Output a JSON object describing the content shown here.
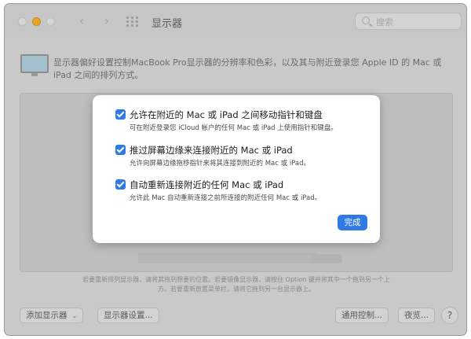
{
  "window": {
    "title": "显示器",
    "search_placeholder": "搜索",
    "back_icon": "‹",
    "forward_icon": "›"
  },
  "header": {
    "description": "显示器偏好设置控制MacBook Pro显示器的分辨率和色彩，以及其与附近登录您 Apple ID 的 Mac 或 iPad 之间的排列方式。"
  },
  "arrangement": {
    "hint_line1": "若要重新排列显示器，请将其拖到想要的位置。若要镜像显示器，请按住 Option 键并将其中一个拖到另一个上",
    "hint_line2": "方。若要重新放置菜单栏，请将它拖到另一台显示器上。"
  },
  "footer": {
    "add_display": "添加显示器",
    "display_settings": "显示器设置...",
    "universal_control": "通用控制...",
    "night_shift": "夜览...",
    "help": "?"
  },
  "sheet": {
    "options": [
      {
        "title": "允许在附近的 Mac 或 iPad 之间移动指针和键盘",
        "subtitle": "可在附近登录您 iCloud 帐户的任何 Mac 或 iPad 上使用指针和键盘。",
        "checked": true
      },
      {
        "title": "推过屏幕边缘来连接附近的 Mac 或 iPad",
        "subtitle": "允许向屏幕边缘拖移指针来将其连接到附近的 Mac 或 iPad。",
        "checked": true
      },
      {
        "title": "自动重新连接附近的任何 Mac 或 iPad",
        "subtitle": "允许此 Mac 自动重新连接之前所连接的附近任何 Mac 或 iPad。",
        "checked": true
      }
    ],
    "done_label": "完成"
  },
  "colors": {
    "accent": "#2f7ae5",
    "window_bg": "#c9c9c9",
    "sheet_bg": "#ffffff"
  }
}
